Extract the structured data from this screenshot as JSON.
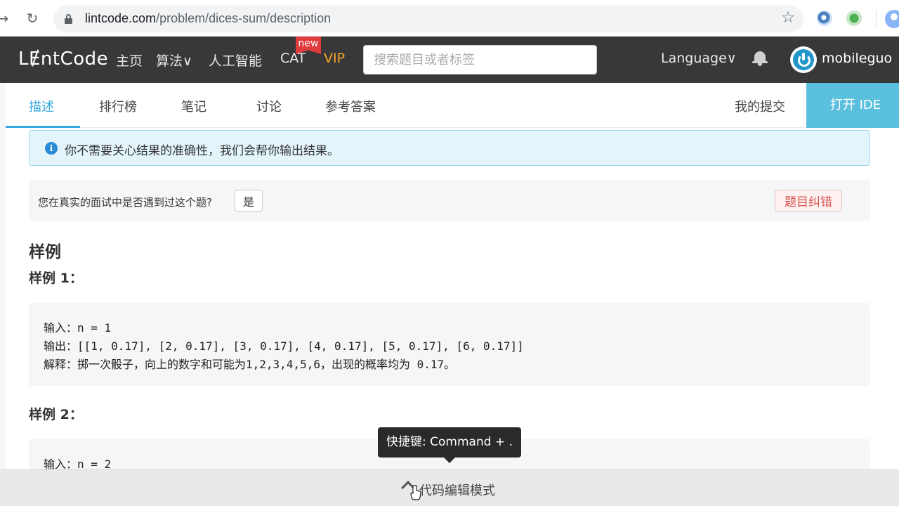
{
  "browser": {
    "url_host": "lintcode.com",
    "url_path": "/problem/dices-sum/description",
    "back_icon": "→",
    "reload_icon": "↻",
    "star_icon": "☆"
  },
  "header": {
    "logo": "LɆntCode",
    "nav": [
      "主页",
      "算法∨",
      "人工智能",
      "CAT",
      "VIP"
    ],
    "new_badge": "new",
    "search_placeholder": "搜索题目或者标签",
    "language": "Language∨",
    "username": "mobileguo"
  },
  "tabs": {
    "items": [
      "描述",
      "排行榜",
      "笔记",
      "讨论",
      "参考答案"
    ],
    "active": "描述",
    "my_submissions": "我的提交",
    "open_ide": "打开 IDE"
  },
  "content": {
    "alert": "你不需要关心结果的准确性，我们会帮你输出结果。",
    "interview_question": "您在真实的面试中是否遇到过这个题?",
    "yes_button": "是",
    "report_button": "题目纠错",
    "section_title": "样例",
    "example1_title": "样例 1：",
    "example1_lines": [
      "输入：n = 1",
      "输出：[[1, 0.17], [2, 0.17], [3, 0.17], [4, 0.17], [5, 0.17], [6, 0.17]]",
      "解释：掷一次骰子，向上的数字和可能为1,2,3,4,5,6，出现的概率均为 0.17。"
    ],
    "example2_title": "样例 2：",
    "example2_lines": [
      "输入：n = 2"
    ]
  },
  "tooltip": "快捷键: Command + .",
  "bottom_bar": {
    "label": "代码编辑模式"
  },
  "colors": {
    "header_bg": "#383838",
    "accent": "#36a9e1",
    "ide_button": "#5bc0de",
    "vip": "#f5a623",
    "new_badge": "#e03c3c",
    "report": "#d9534f"
  }
}
